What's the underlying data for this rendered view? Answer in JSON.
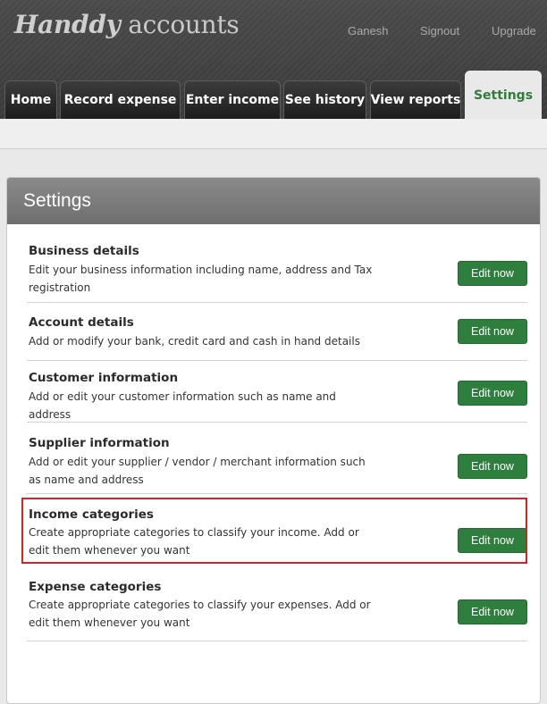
{
  "app": {
    "logo_part1": "Handdy",
    "logo_part2": " accounts"
  },
  "top_links": {
    "user": "Ganesh",
    "signout": "Signout",
    "upgrade": "Upgrade"
  },
  "tabs": [
    {
      "label": "Home"
    },
    {
      "label": "Record expense"
    },
    {
      "label": "Enter income"
    },
    {
      "label": "See history"
    },
    {
      "label": "View reports"
    },
    {
      "label": "Settings"
    }
  ],
  "panel": {
    "title": "Settings"
  },
  "sections": [
    {
      "title": "Business details",
      "description": "Edit your business information including name, address and Tax registration",
      "button": "Edit now"
    },
    {
      "title": "Account details",
      "description": "Add or modify your bank, credit card and cash in hand details",
      "button": "Edit now"
    },
    {
      "title": "Customer information",
      "description": "Add or edit your customer information such as name and address",
      "button": "Edit now"
    },
    {
      "title": "Supplier information",
      "description": "Add or edit your supplier / vendor / merchant information such as name and address",
      "button": "Edit now"
    },
    {
      "title": "Income categories",
      "description": "Create appropriate categories to classify your income. Add or edit them whenever you want",
      "button": "Edit now"
    },
    {
      "title": "Expense categories",
      "description": "Create appropriate categories to classify your expenses. Add or edit them whenever you want",
      "button": "Edit now"
    }
  ],
  "colors": {
    "accent_green": "#2e7f3e",
    "highlight_red": "#d42323",
    "active_tab_text": "#2f7d3b"
  }
}
